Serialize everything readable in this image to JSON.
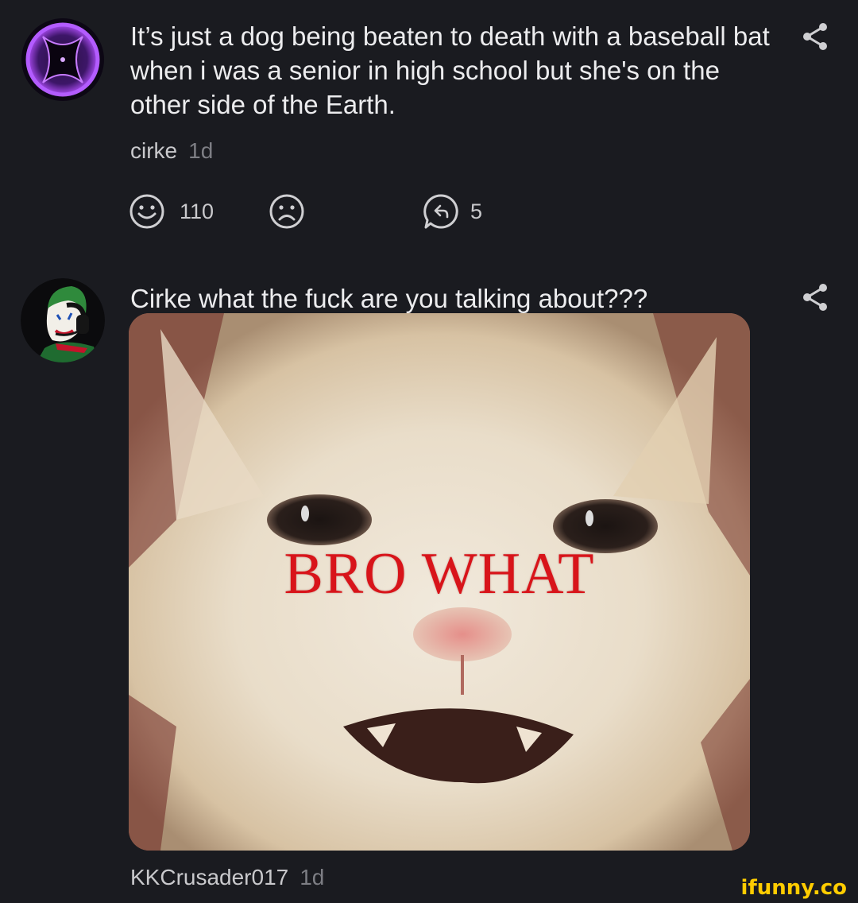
{
  "comments": [
    {
      "text": "It’s just a dog being beaten to death with a baseball bat when i was a senior in high school but she's on the other side of the Earth.",
      "author": "cirke",
      "time": "1d",
      "smile_count": "110",
      "reply_count": "5",
      "avatar_icon": "hourglass-orb-icon"
    },
    {
      "text": "Cirke what the fuck are you talking about???",
      "author": "KKCrusader017",
      "time": "1d",
      "avatar_icon": "joker-headset-icon",
      "image_caption": "BRO WHAT"
    }
  ],
  "watermark": "ifunny.co",
  "colors": {
    "background": "#1a1b20",
    "text": "#ececee",
    "muted": "#7d7e84",
    "watermark": "#ffcc00",
    "caption_red": "#d8141a"
  }
}
